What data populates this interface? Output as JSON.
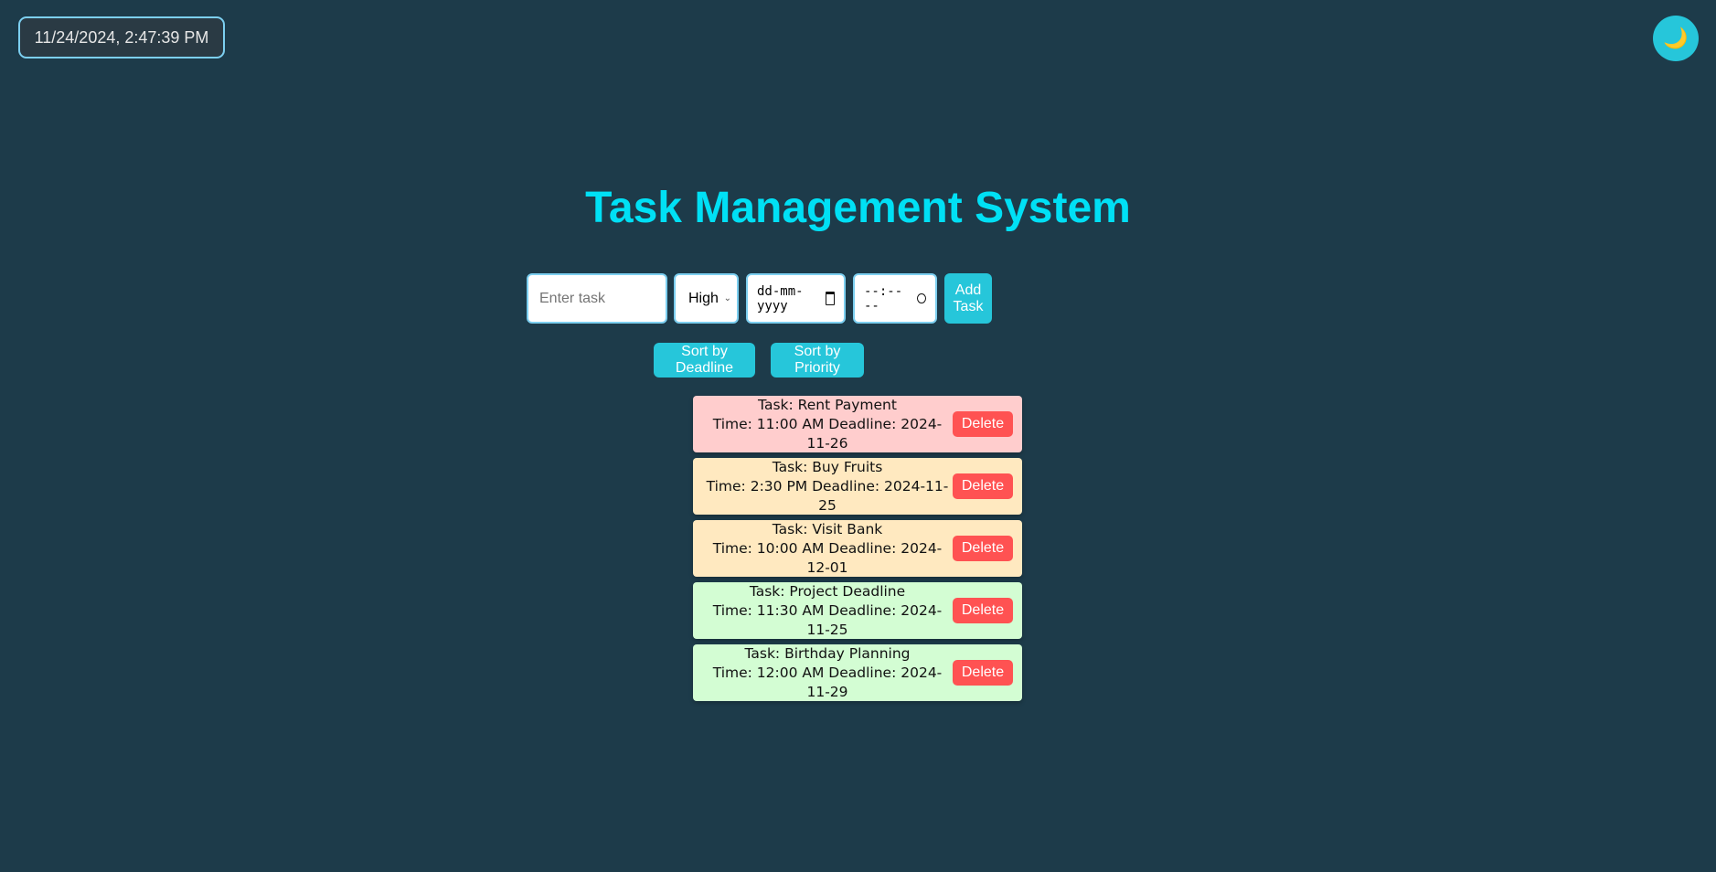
{
  "clock": "11/24/2024, 2:47:39 PM",
  "theme_toggle": {
    "icon": "moon-icon",
    "glyph": "🌙"
  },
  "title": "Task Management System",
  "form": {
    "task_placeholder": "Enter task",
    "priority_value": "High",
    "date_placeholder": "dd-mm-yyyy",
    "time_placeholder": "--:-- --",
    "add_label": "Add Task"
  },
  "sort": {
    "deadline_label": "Sort by Deadline",
    "priority_label": "Sort by Priority"
  },
  "colors": {
    "accent": "#26c6da",
    "high": "#ffcdcd",
    "medium": "#ffe9c0",
    "low": "#d3fdd3",
    "delete": "#ff5252"
  },
  "tasks": [
    {
      "task": "Task: Rent Payment",
      "meta": "Time: 11:00 AM Deadline: 2024-11-26",
      "priority": "high",
      "delete": "Delete"
    },
    {
      "task": "Task: Buy Fruits",
      "meta": "Time: 2:30 PM Deadline: 2024-11-25",
      "priority": "medium",
      "delete": "Delete"
    },
    {
      "task": "Task: Visit Bank",
      "meta": "Time: 10:00 AM Deadline: 2024-12-01",
      "priority": "medium",
      "delete": "Delete"
    },
    {
      "task": "Task: Project Deadline",
      "meta": "Time: 11:30 AM Deadline: 2024-11-25",
      "priority": "low",
      "delete": "Delete"
    },
    {
      "task": "Task: Birthday Planning",
      "meta": "Time: 12:00 AM Deadline: 2024-11-29",
      "priority": "low",
      "delete": "Delete"
    }
  ]
}
